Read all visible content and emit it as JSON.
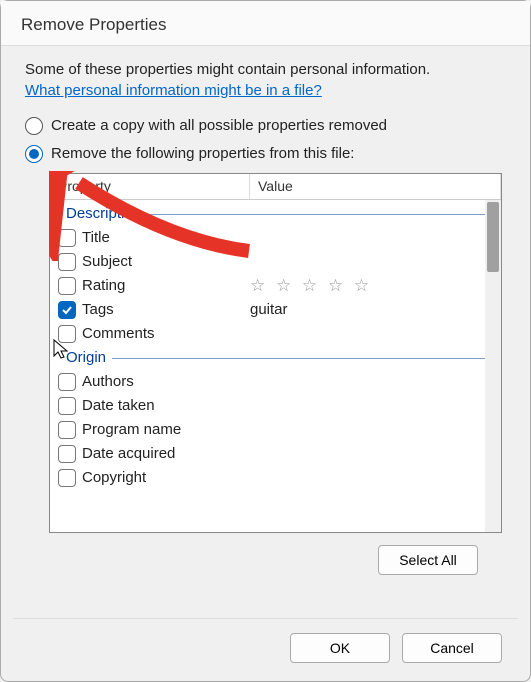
{
  "title": "Remove Properties",
  "intro": "Some of these properties might contain personal information.",
  "link": "What personal information might be in a file?",
  "radios": [
    {
      "label": "Create a copy with all possible properties removed",
      "checked": false
    },
    {
      "label": "Remove the following properties from this file:",
      "checked": true
    }
  ],
  "list": {
    "headers": {
      "property": "Property",
      "value": "Value"
    },
    "groups": [
      {
        "name": "Description",
        "items": [
          {
            "label": "Title",
            "value": "",
            "checked": false,
            "type": "text"
          },
          {
            "label": "Subject",
            "value": "",
            "checked": false,
            "type": "text"
          },
          {
            "label": "Rating",
            "value": "",
            "checked": false,
            "type": "stars"
          },
          {
            "label": "Tags",
            "value": "guitar",
            "checked": true,
            "type": "text"
          },
          {
            "label": "Comments",
            "value": "",
            "checked": false,
            "type": "text"
          }
        ]
      },
      {
        "name": "Origin",
        "items": [
          {
            "label": "Authors",
            "value": "",
            "checked": false,
            "type": "text"
          },
          {
            "label": "Date taken",
            "value": "",
            "checked": false,
            "type": "text"
          },
          {
            "label": "Program name",
            "value": "",
            "checked": false,
            "type": "text"
          },
          {
            "label": "Date acquired",
            "value": "",
            "checked": false,
            "type": "text"
          },
          {
            "label": "Copyright",
            "value": "",
            "checked": false,
            "type": "text"
          }
        ]
      }
    ]
  },
  "buttons": {
    "select_all": "Select All",
    "ok": "OK",
    "cancel": "Cancel"
  },
  "stars_display": "☆ ☆ ☆ ☆ ☆",
  "colors": {
    "accent": "#0067c0",
    "link": "#0066cc",
    "group_header": "#003d99",
    "arrow": "#e63328"
  }
}
